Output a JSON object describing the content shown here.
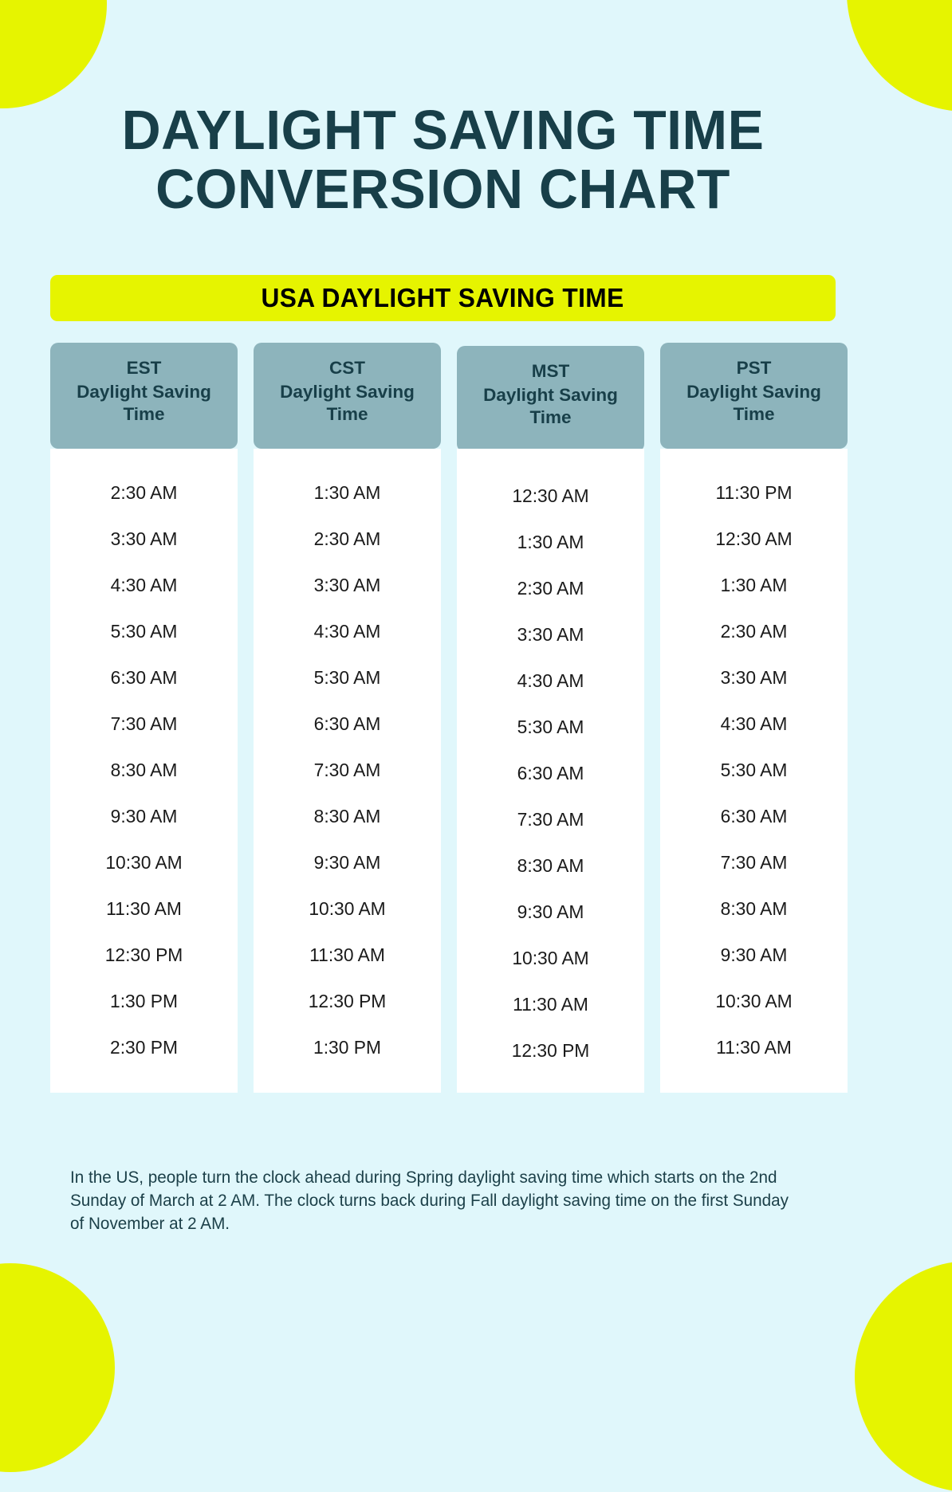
{
  "theme": {
    "background": "#e0f7fb",
    "accent_yellow": "#e6f400",
    "dark_teal": "#183f49",
    "header_teal": "#8db4bc",
    "cell_bg": "#ffffff"
  },
  "title": {
    "line1": "DAYLIGHT SAVING TIME",
    "line2": "CONVERSION CHART"
  },
  "banner": {
    "label": "USA DAYLIGHT SAVING TIME"
  },
  "chart_data": {
    "type": "table",
    "title": "DAYLIGHT SAVING TIME CONVERSION CHART",
    "subtitle": "USA DAYLIGHT SAVING TIME",
    "columns": [
      {
        "abbr": "EST",
        "sub": "Daylight Saving Time"
      },
      {
        "abbr": "CST",
        "sub": "Daylight Saving Time"
      },
      {
        "abbr": "MST",
        "sub": "Daylight Saving Time"
      },
      {
        "abbr": "PST",
        "sub": "Daylight Saving Time"
      }
    ],
    "rows": [
      [
        "2:30 AM",
        "1:30 AM",
        "12:30 AM",
        "11:30 PM"
      ],
      [
        "3:30 AM",
        "2:30 AM",
        "1:30 AM",
        "12:30 AM"
      ],
      [
        "4:30 AM",
        "3:30 AM",
        "2:30 AM",
        "1:30 AM"
      ],
      [
        "5:30 AM",
        "4:30 AM",
        "3:30 AM",
        "2:30 AM"
      ],
      [
        "6:30 AM",
        "5:30 AM",
        "4:30 AM",
        "3:30 AM"
      ],
      [
        "7:30 AM",
        "6:30 AM",
        "5:30 AM",
        "4:30 AM"
      ],
      [
        "8:30 AM",
        "7:30 AM",
        "6:30 AM",
        "5:30 AM"
      ],
      [
        "9:30 AM",
        "8:30 AM",
        "7:30 AM",
        "6:30 AM"
      ],
      [
        "10:30 AM",
        "9:30 AM",
        "8:30 AM",
        "7:30 AM"
      ],
      [
        "11:30 AM",
        "10:30 AM",
        "9:30 AM",
        "8:30 AM"
      ],
      [
        "12:30 PM",
        "11:30 AM",
        "10:30 AM",
        "9:30 AM"
      ],
      [
        "1:30 PM",
        "12:30 PM",
        "11:30 AM",
        "10:30 AM"
      ],
      [
        "2:30 PM",
        "1:30 PM",
        "12:30 PM",
        "11:30 AM"
      ]
    ]
  },
  "footer": {
    "note": "In the US, people turn the clock ahead during Spring daylight saving time which starts on the 2nd Sunday of March at 2 AM. The clock turns back during Fall daylight saving time on the first Sunday of November at 2 AM."
  }
}
